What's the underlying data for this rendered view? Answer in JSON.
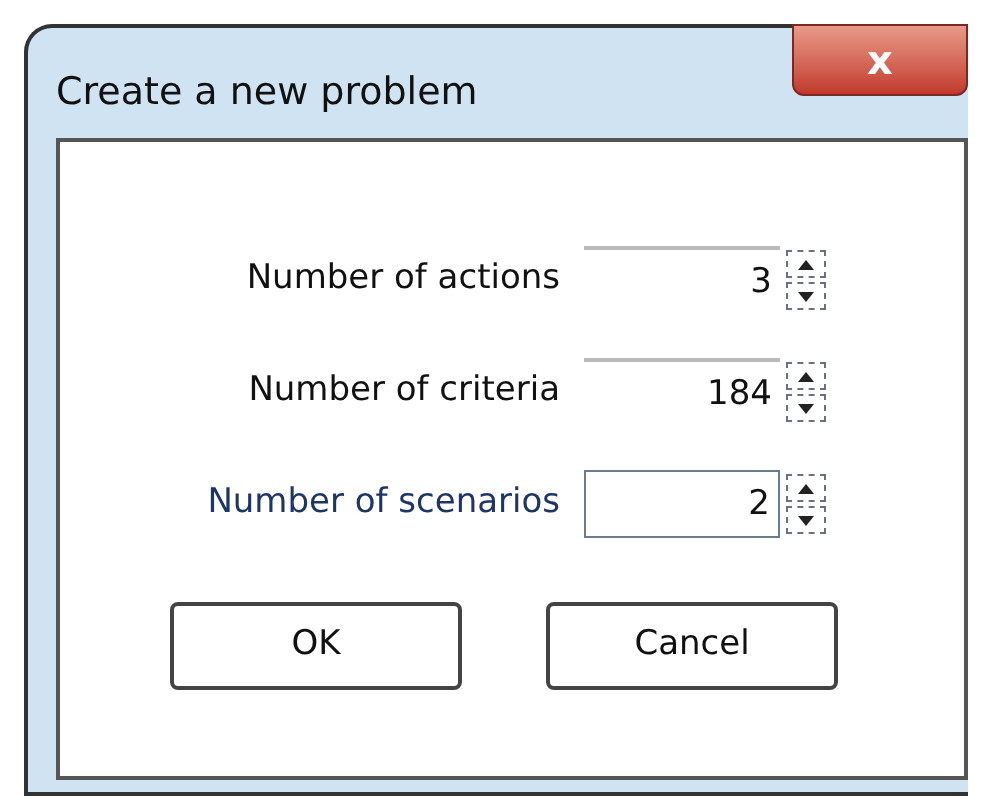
{
  "window": {
    "title": "Create a new problem",
    "close": "x"
  },
  "fields": [
    {
      "label": "Number of actions",
      "value": "3",
      "focused": false
    },
    {
      "label": "Number of criteria",
      "value": "184",
      "focused": false
    },
    {
      "label": "Number of scenarios",
      "value": "2",
      "focused": true
    }
  ],
  "buttons": [
    "OK",
    "Cancel"
  ]
}
